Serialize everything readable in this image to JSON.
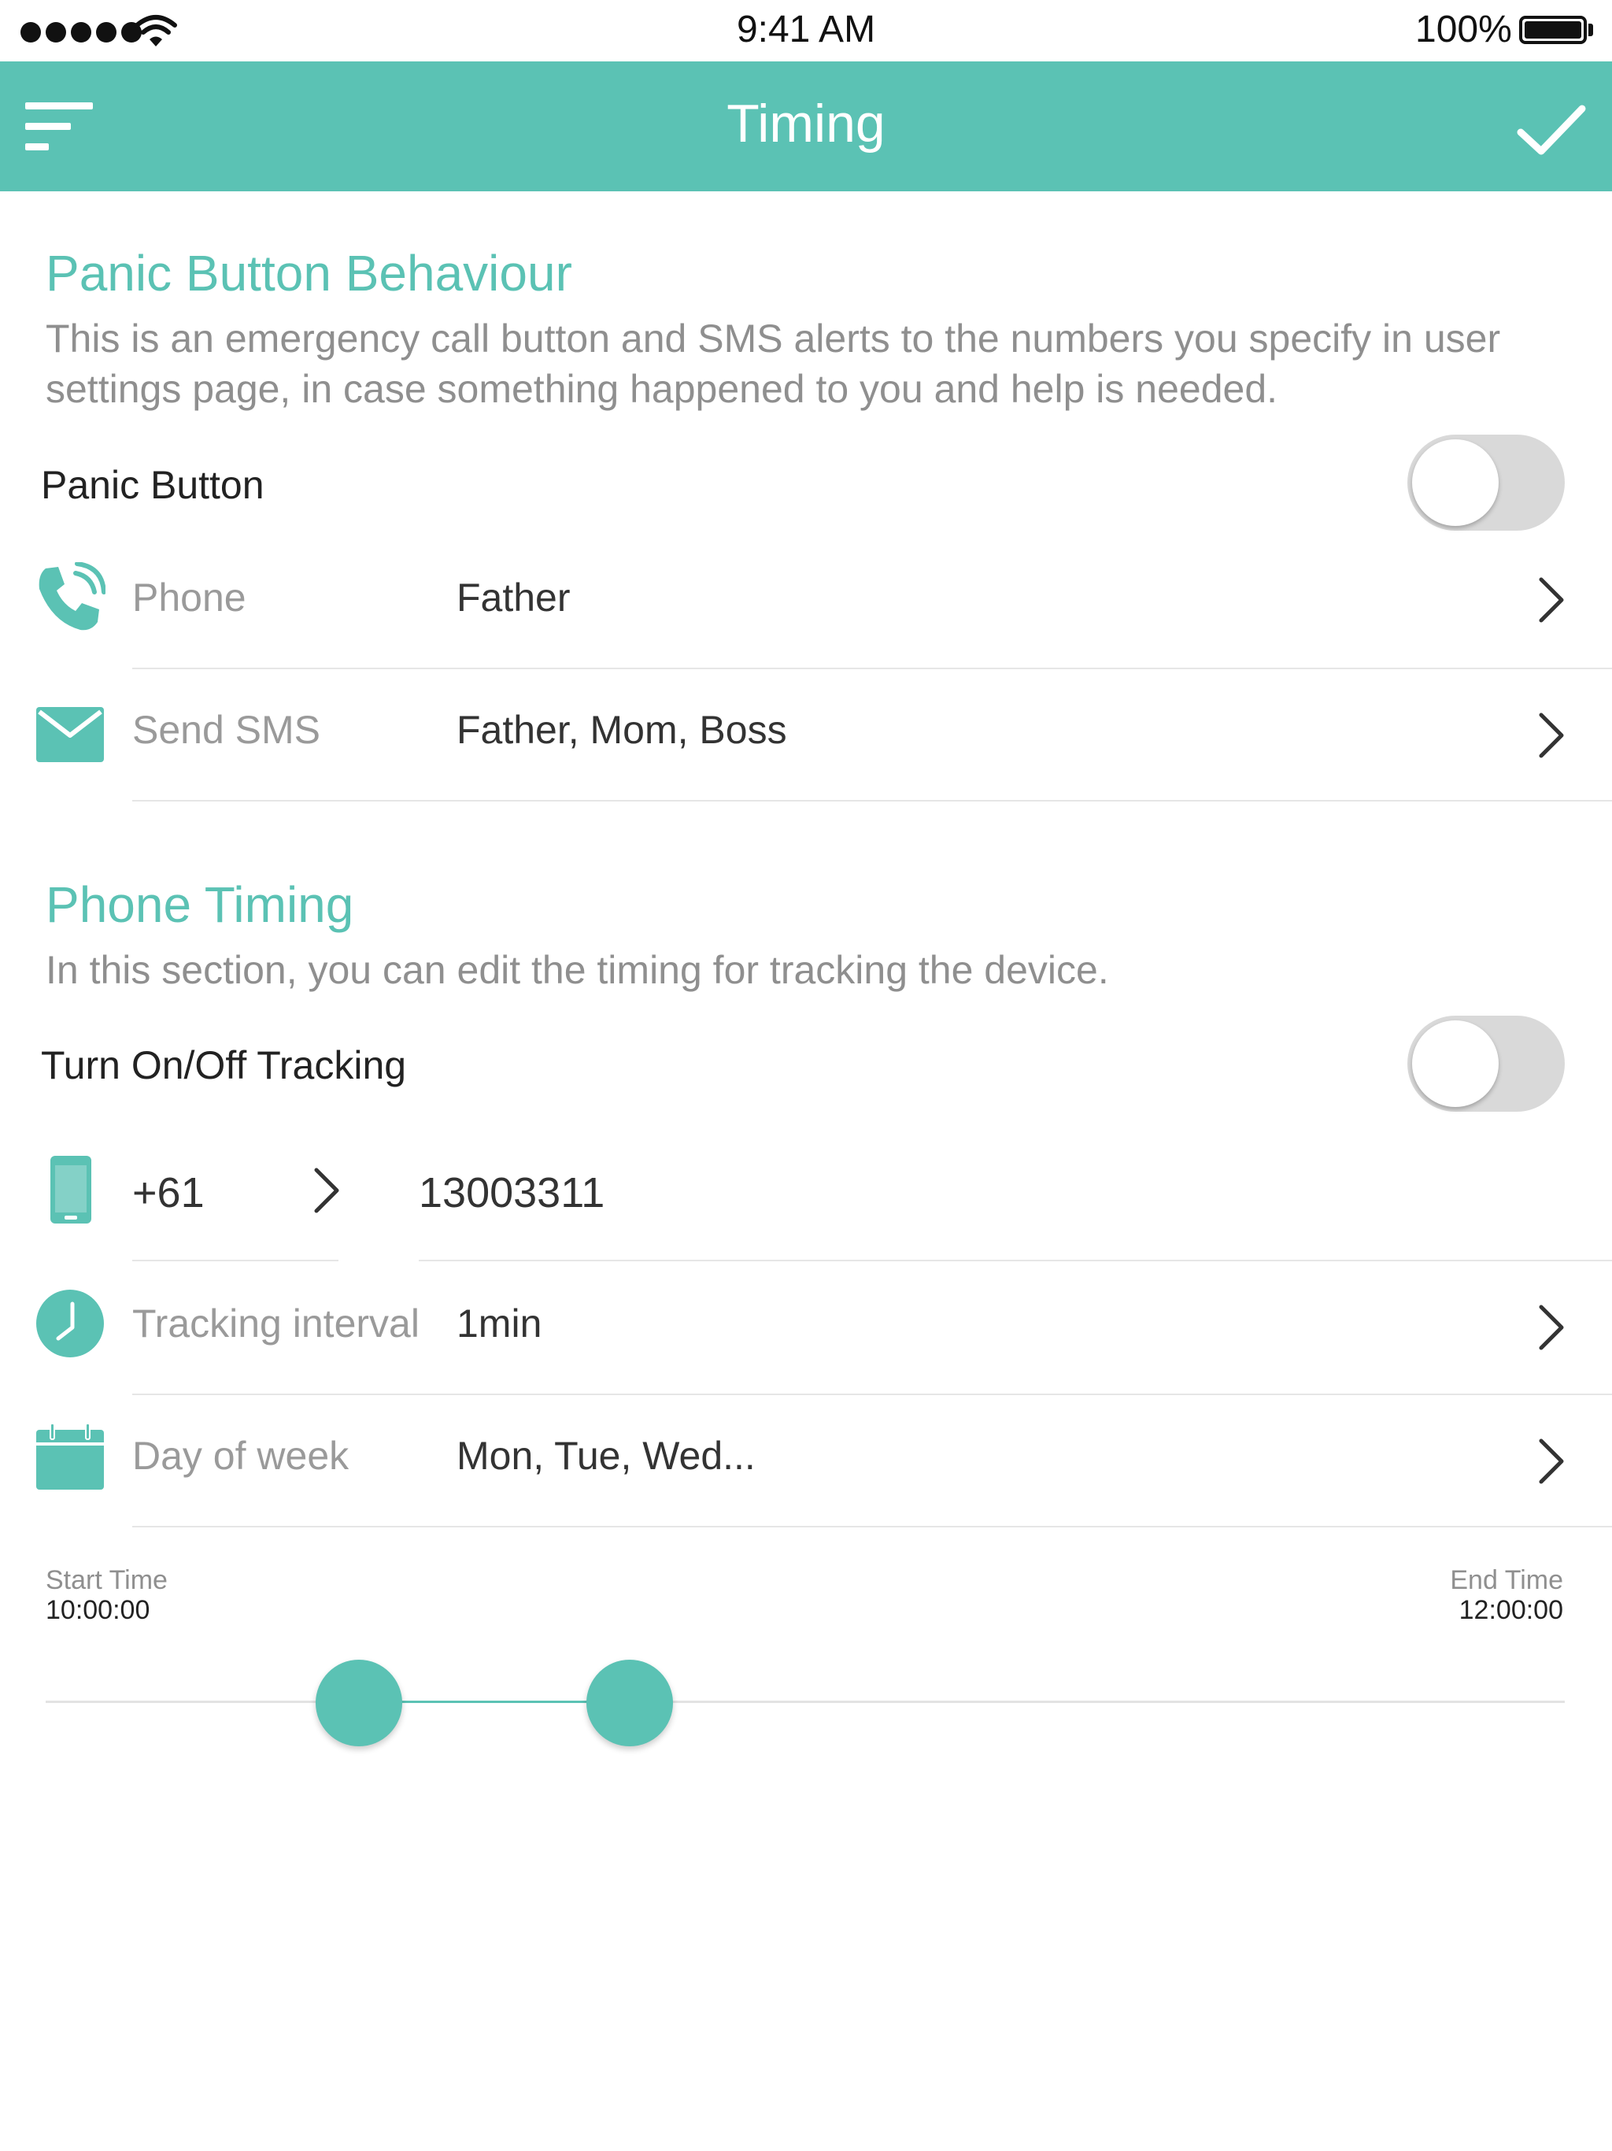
{
  "status_bar": {
    "time": "9:41 AM",
    "battery": "100%",
    "signal_bars": 5
  },
  "navbar": {
    "title": "Timing",
    "menu_icon": "menu-icon",
    "done_icon": "checkmark-icon"
  },
  "panic": {
    "title": "Panic Button Behaviour",
    "description": "This is an emergency call button and SMS alerts to the numbers you specify in user settings page, in case something happened to you and help is needed.",
    "toggle_label": "Panic Button",
    "toggle_on": false,
    "rows": [
      {
        "icon": "phone-icon",
        "label": "Phone",
        "value": "Father"
      },
      {
        "icon": "mail-icon",
        "label": "Send SMS",
        "value": "Father, Mom, Boss"
      }
    ]
  },
  "timing": {
    "title": "Phone Timing",
    "description": "In this section, you can edit the timing for tracking the device.",
    "toggle_label": "Turn On/Off Tracking",
    "toggle_on": false,
    "country_code": "+61",
    "phone_number": "13003311",
    "rows": [
      {
        "icon": "clock-icon",
        "label": "Tracking interval",
        "value": "1min"
      },
      {
        "icon": "calendar-icon",
        "label": "Day of week",
        "value": "Mon, Tue, Wed..."
      }
    ]
  },
  "time_range": {
    "start_label": "Start Time",
    "start_value": "10:00:00",
    "end_label": "End Time",
    "end_value": "12:00:00"
  },
  "colors": {
    "accent": "#5bc2b4",
    "toggle_off": "#d9d9d9"
  }
}
